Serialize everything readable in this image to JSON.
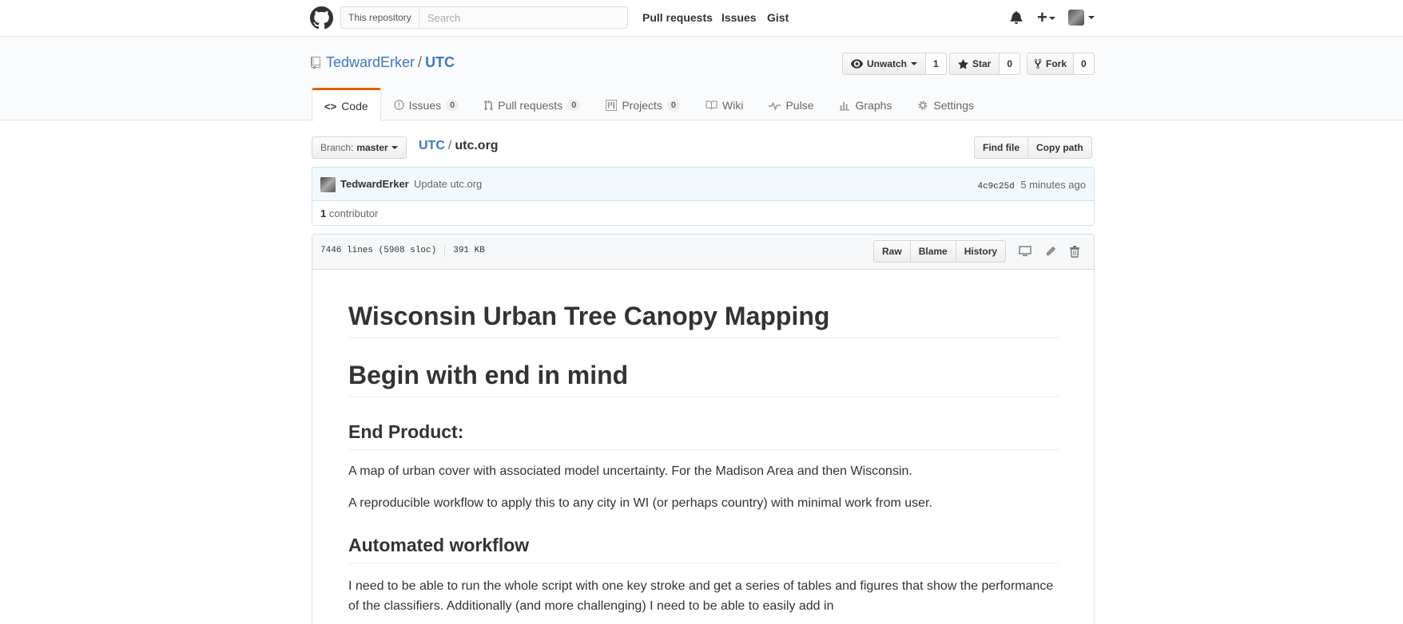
{
  "header": {
    "search_scope": "This repository",
    "search_placeholder": "Search",
    "nav": [
      "Pull requests",
      "Issues",
      "Gist"
    ]
  },
  "repo": {
    "owner": "TedwardErker",
    "separator": "/",
    "name": "UTC",
    "watch": {
      "label": "Unwatch",
      "count": "1"
    },
    "star": {
      "label": "Star",
      "count": "0"
    },
    "fork": {
      "label": "Fork",
      "count": "0"
    }
  },
  "tabs": [
    {
      "label": "Code",
      "icon": "code-icon"
    },
    {
      "label": "Issues",
      "count": "0",
      "icon": "issue-icon"
    },
    {
      "label": "Pull requests",
      "count": "0",
      "icon": "pull-request-icon"
    },
    {
      "label": "Projects",
      "count": "0",
      "icon": "project-icon"
    },
    {
      "label": "Wiki",
      "icon": "book-icon"
    },
    {
      "label": "Pulse",
      "icon": "pulse-icon"
    },
    {
      "label": "Graphs",
      "icon": "graph-icon"
    },
    {
      "label": "Settings",
      "icon": "gear-icon"
    }
  ],
  "file_nav": {
    "branch_label": "Branch:",
    "branch_value": "master",
    "breadcrumb_root": "UTC",
    "breadcrumb_sep": "/",
    "breadcrumb_file": "utc.org",
    "find_file": "Find file",
    "copy_path": "Copy path"
  },
  "commit": {
    "author": "TedwardErker",
    "message": "Update utc.org",
    "sha": "4c9c25d",
    "time": "5 minutes ago",
    "contributor_count": "1",
    "contributor_label": "contributor"
  },
  "file": {
    "lines": "7446 lines (5908 sloc)",
    "size": "391 KB",
    "actions": [
      "Raw",
      "Blame",
      "History"
    ]
  },
  "markdown": {
    "h1": "Wisconsin Urban Tree Canopy Mapping",
    "h2a": "Begin with end in mind",
    "h3a": "End Product:",
    "p1": "A map of urban cover with associated model uncertainty. For the Madison Area and then Wisconsin.",
    "p2": "A reproducible workflow to apply this to any city in WI (or perhaps country) with minimal work from user.",
    "h3b": "Automated workflow",
    "p3": "I need to be able to run the whole script with one key stroke and get a series of tables and figures that show the performance of the classifiers. Additionally (and more challenging) I need to be able to easily add in"
  },
  "colors": {
    "link": "#4078c0",
    "tab_accent": "#e36209",
    "commit_bg": "#f2f9fc"
  }
}
